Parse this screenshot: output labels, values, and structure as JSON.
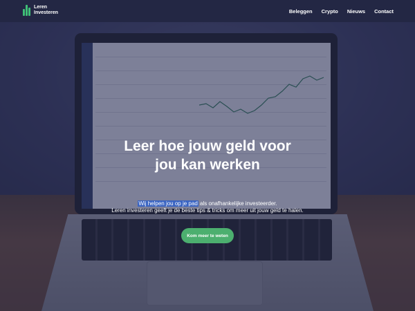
{
  "brand": {
    "line1": "Leren",
    "line2": "Investeren",
    "accent": "#3fbf77"
  },
  "nav": {
    "items": [
      "Beleggen",
      "Crypto",
      "Nieuws",
      "Contact"
    ]
  },
  "hero": {
    "title_line1": "Leer hoe jouw geld voor",
    "title_line2": "jou kan werken",
    "sub_highlight": "Wij helpen jou op je pad",
    "sub_rest": " als onafhankelijke investeerder.",
    "sub_line2": "Leren investeren geeft je de beste tips & tricks om meer uit jouw geld te halen.",
    "cta_label": "Kom meer te weten",
    "cta_color": "#4caf6f",
    "overlay_color": "#262a50"
  }
}
